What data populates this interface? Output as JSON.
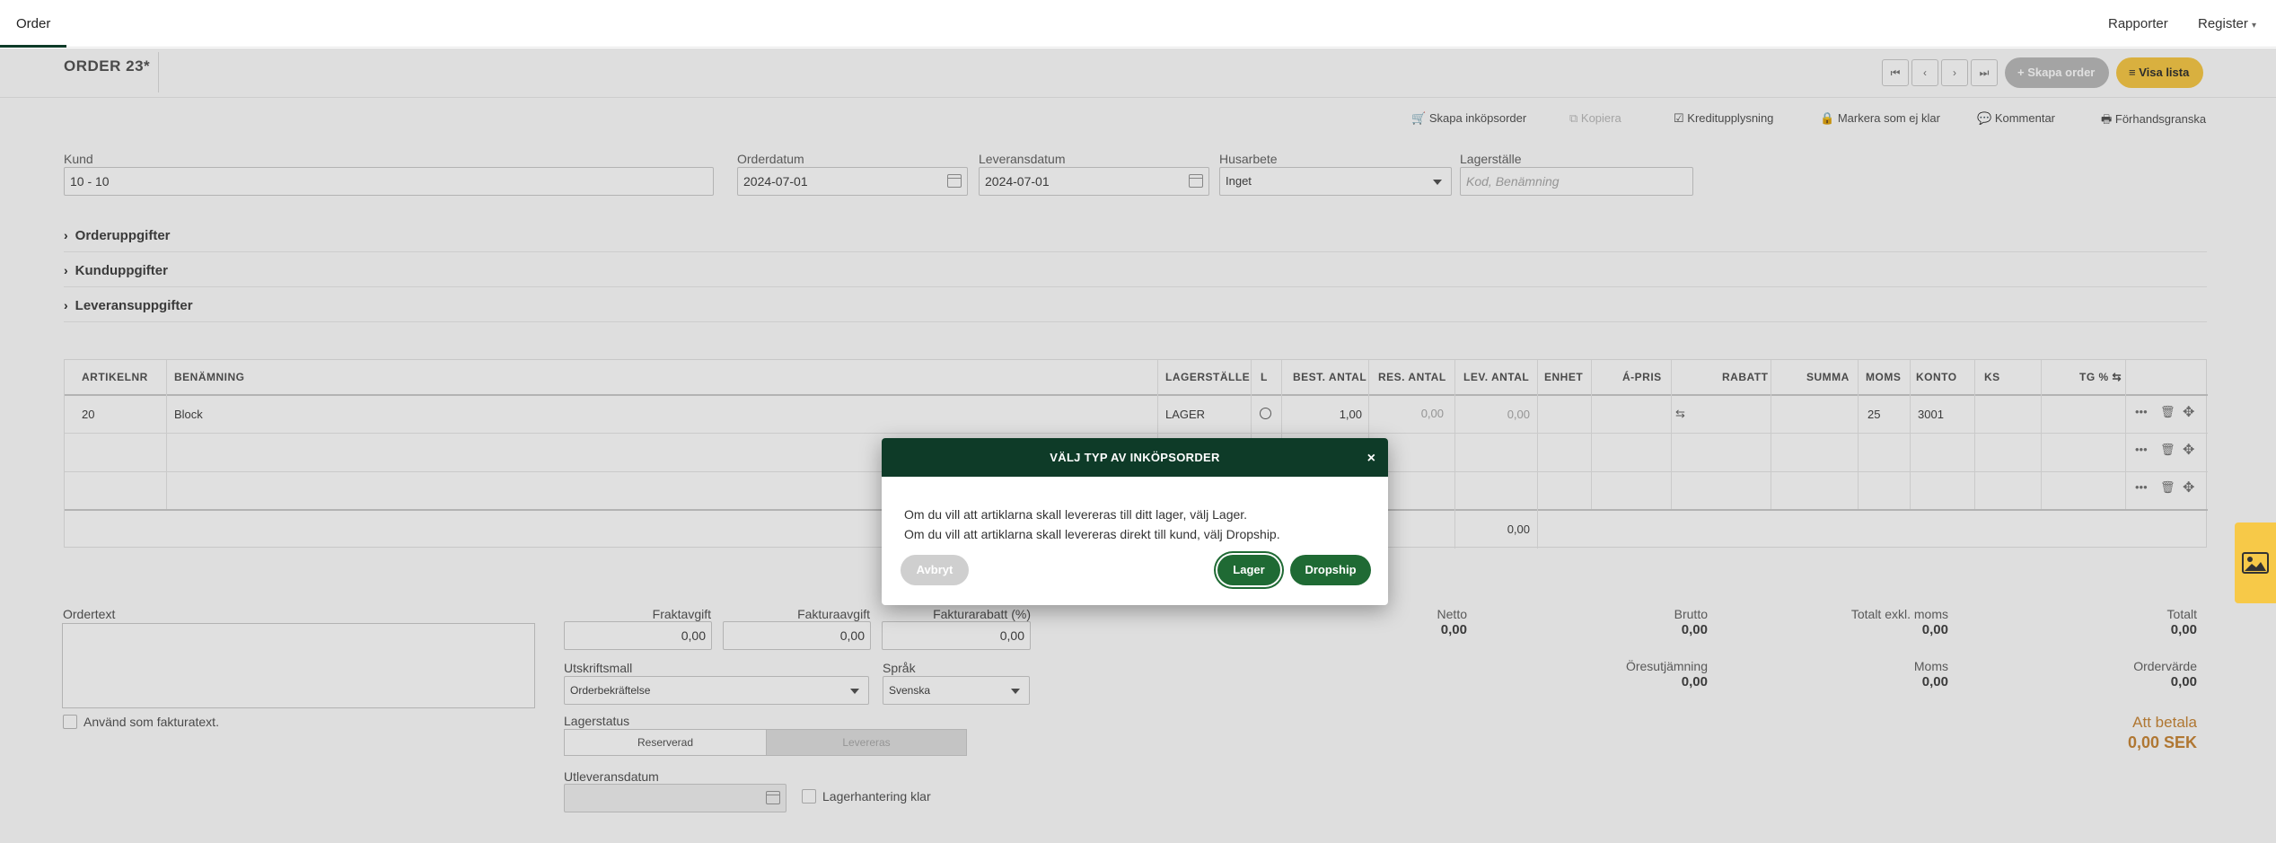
{
  "topbar": {
    "tab": "Order",
    "rapporter": "Rapporter",
    "register": "Register"
  },
  "header": {
    "title": "ORDER 23*",
    "skapa_order": "Skapa order",
    "visa_lista": "Visa lista"
  },
  "toolbar": {
    "skapa_inkopsorder": "Skapa inköpsorder",
    "kopiera": "Kopiera",
    "kreditupplysning": "Kreditupplysning",
    "markera": "Markera som ej klar",
    "kommentar": "Kommentar",
    "forhandsgranska": "Förhandsgranska"
  },
  "form": {
    "kund_label": "Kund",
    "kund_value": "10 - 10",
    "orderdatum_label": "Orderdatum",
    "orderdatum_value": "2024-07-01",
    "leveransdatum_label": "Leveransdatum",
    "leveransdatum_value": "2024-07-01",
    "husarbete_label": "Husarbete",
    "husarbete_value": "Inget",
    "lagerstalle_label": "Lagerställe",
    "lagerstalle_placeholder": "Kod, Benämning"
  },
  "sections": [
    "Orderuppgifter",
    "Kunduppgifter",
    "Leveransuppgifter"
  ],
  "grid": {
    "columns": [
      "ARTIKELNR",
      "BENÄMNING",
      "LAGERSTÄLLE",
      "L",
      "BEST. ANTAL",
      "RES. ANTAL",
      "LEV. ANTAL",
      "ENHET",
      "Á-PRIS",
      "RABATT",
      "SUMMA",
      "MOMS",
      "KONTO",
      "KS",
      "TG %"
    ],
    "row1": {
      "artikelnr": "20",
      "benamning": "Block",
      "lagerstalle": "LAGER",
      "best_antal": "1,00",
      "res_antal": "0,00",
      "lev_antal": "0,00",
      "moms": "25",
      "konto": "3001"
    },
    "footer_total": "0,00"
  },
  "bottom": {
    "ordertext_label": "Ordertext",
    "anvand_label": "Använd som fakturatext.",
    "fraktavgift_label": "Fraktavgift",
    "fraktavgift_value": "0,00",
    "fakturaavgift_label": "Fakturaavgift",
    "fakturaavgift_value": "0,00",
    "fakturarabatt_label": "Fakturarabatt (%)",
    "fakturarabatt_value": "0,00",
    "utskriftsmall_label": "Utskriftsmall",
    "utskriftsmall_value": "Orderbekräftelse",
    "sprak_label": "Språk",
    "sprak_value": "Svenska",
    "lagerstatus_label": "Lagerstatus",
    "reserverad": "Reserverad",
    "levereras": "Levereras",
    "utleveransdatum_label": "Utleveransdatum",
    "lagerhantering_label": "Lagerhantering klar"
  },
  "summary": {
    "netto_label": "Netto",
    "netto": "0,00",
    "brutto_label": "Brutto",
    "brutto": "0,00",
    "totalt_exkl_label": "Totalt exkl. moms",
    "totalt_exkl": "0,00",
    "totalt_label": "Totalt",
    "totalt": "0,00",
    "oresutjamning_label": "Öresutjämning",
    "oresutjamning": "0,00",
    "moms_label": "Moms",
    "moms": "0,00",
    "ordervarde_label": "Ordervärde",
    "ordervarde": "0,00",
    "att_betala_label": "Att betala",
    "att_betala": "0,00 SEK"
  },
  "modal": {
    "title": "VÄLJ TYP AV INKÖPSORDER",
    "line1": "Om du vill att artiklarna skall levereras till ditt lager, välj Lager.",
    "line2": "Om du vill att artiklarna skall levereras direkt till kund, välj Dropship.",
    "avbryt": "Avbryt",
    "lager": "Lager",
    "dropship": "Dropship"
  },
  "colors": {
    "brand_dark_green": "#0e3b28",
    "button_green": "#1f6a34",
    "accent_yellow": "#f7c948",
    "att_betala": "#c9883a"
  }
}
